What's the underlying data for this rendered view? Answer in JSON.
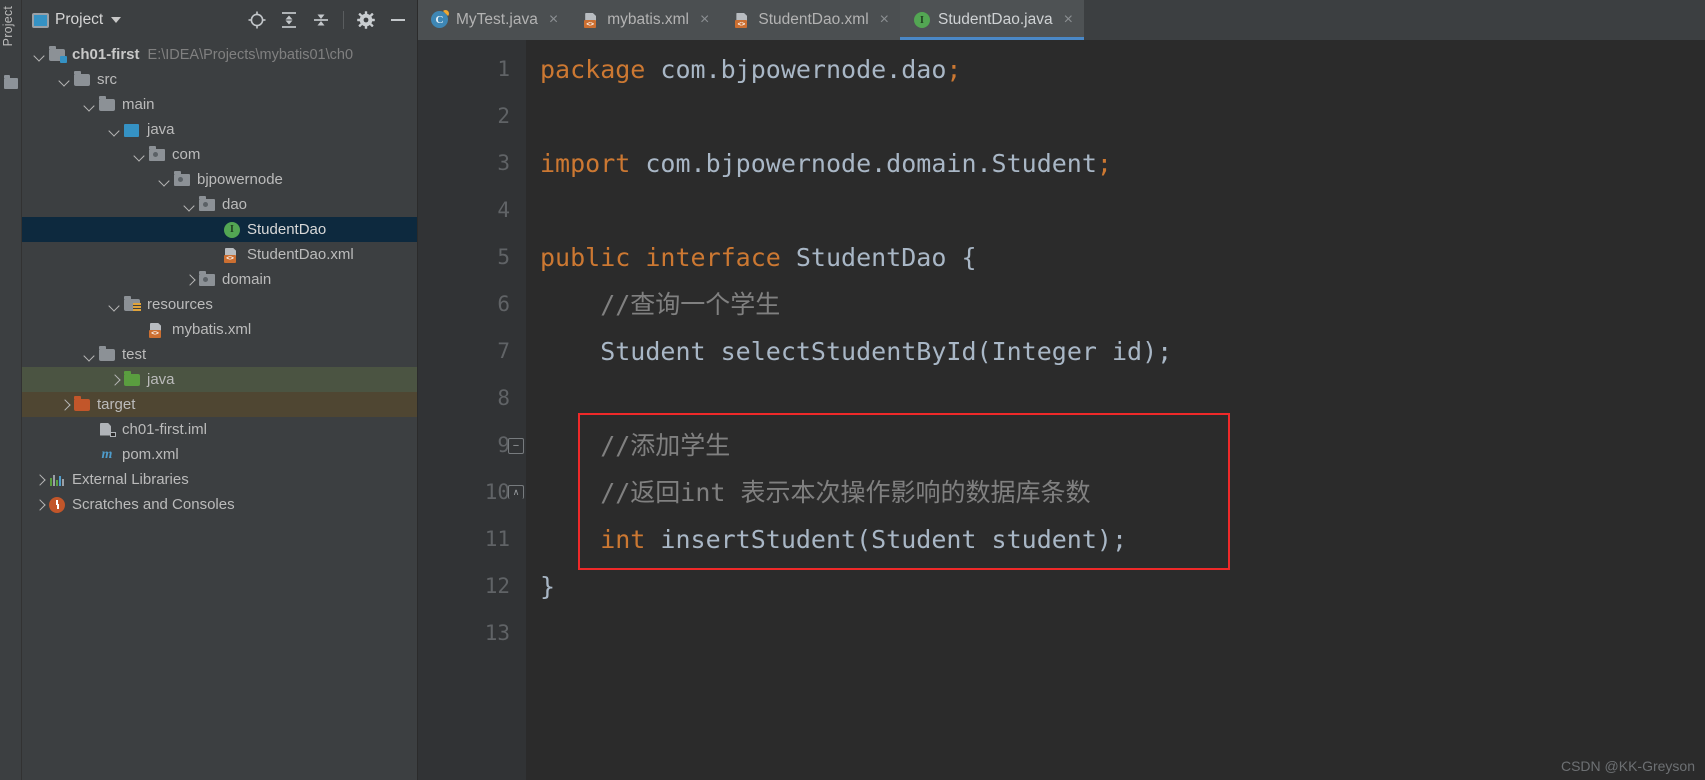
{
  "left_strip": {
    "label": "Project",
    "icon": "project-tool-window-icon"
  },
  "project_panel": {
    "header": {
      "title": "Project",
      "icon": "project-view-icon",
      "dropdown_icon": "chevron-down-icon",
      "buttons": [
        {
          "name": "locate-icon",
          "label": ""
        },
        {
          "name": "expand-all-icon",
          "label": ""
        },
        {
          "name": "collapse-all-icon",
          "label": ""
        },
        {
          "name": "gear-icon",
          "label": ""
        },
        {
          "name": "minimize-icon",
          "label": ""
        }
      ]
    },
    "tree": [
      {
        "label": "ch01-first",
        "path": "E:\\IDEA\\Projects\\mybatis01\\ch0",
        "arrow": "down",
        "icon": "module-folder-icon",
        "indent": 0,
        "bold": true,
        "state": "normal"
      },
      {
        "label": "src",
        "arrow": "down",
        "icon": "folder-icon",
        "indent": 1,
        "state": "normal"
      },
      {
        "label": "main",
        "arrow": "down",
        "icon": "folder-icon",
        "indent": 2,
        "state": "normal"
      },
      {
        "label": "java",
        "arrow": "down",
        "icon": "source-root-icon",
        "indent": 3,
        "state": "normal"
      },
      {
        "label": "com",
        "arrow": "down",
        "icon": "package-icon",
        "indent": 4,
        "state": "normal"
      },
      {
        "label": "bjpowernode",
        "arrow": "down",
        "icon": "package-icon",
        "indent": 5,
        "state": "normal"
      },
      {
        "label": "dao",
        "arrow": "down",
        "icon": "package-icon",
        "indent": 6,
        "state": "normal"
      },
      {
        "label": "StudentDao",
        "arrow": "none",
        "icon": "interface-icon",
        "indent": 7,
        "state": "selected"
      },
      {
        "label": "StudentDao.xml",
        "arrow": "none",
        "icon": "xml-file-icon",
        "indent": 7,
        "state": "normal"
      },
      {
        "label": "domain",
        "arrow": "right",
        "icon": "package-icon",
        "indent": 6,
        "state": "normal"
      },
      {
        "label": "resources",
        "arrow": "down",
        "icon": "resources-folder-icon",
        "indent": 3,
        "state": "normal"
      },
      {
        "label": "mybatis.xml",
        "arrow": "none",
        "icon": "xml-file-icon",
        "indent": 4,
        "state": "normal"
      },
      {
        "label": "test",
        "arrow": "down",
        "icon": "folder-icon",
        "indent": 2,
        "state": "normal"
      },
      {
        "label": "java",
        "arrow": "right",
        "icon": "test-source-root-icon",
        "indent": 3,
        "state": "tint-green"
      },
      {
        "label": "target",
        "arrow": "right",
        "icon": "excluded-folder-icon",
        "indent": 1,
        "state": "tint-olive"
      },
      {
        "label": "ch01-first.iml",
        "arrow": "none",
        "icon": "iml-file-icon",
        "indent": 2,
        "state": "normal"
      },
      {
        "label": "pom.xml",
        "arrow": "none",
        "icon": "maven-file-icon",
        "indent": 2,
        "state": "normal"
      },
      {
        "label": "External Libraries",
        "arrow": "right",
        "icon": "libraries-icon",
        "indent": 0,
        "state": "normal"
      },
      {
        "label": "Scratches and Consoles",
        "arrow": "right",
        "icon": "scratches-icon",
        "indent": 0,
        "state": "normal"
      }
    ]
  },
  "editor": {
    "tabs": [
      {
        "label": "MyTest.java",
        "icon": "java-class-icon",
        "active": false,
        "close_icon": "close-icon"
      },
      {
        "label": "mybatis.xml",
        "icon": "xml-file-icon",
        "active": false,
        "close_icon": "close-icon"
      },
      {
        "label": "StudentDao.xml",
        "icon": "xml-file-icon",
        "active": false,
        "close_icon": "close-icon"
      },
      {
        "label": "StudentDao.java",
        "icon": "interface-icon",
        "active": true,
        "close_icon": "close-icon"
      }
    ],
    "line_numbers": [
      "1",
      "2",
      "3",
      "4",
      "5",
      "6",
      "7",
      "8",
      "9",
      "10",
      "11",
      "12",
      "13"
    ],
    "lines": [
      {
        "num": "1",
        "tokens": [
          {
            "t": "package",
            "c": "kw"
          },
          {
            "t": " com.bjpowernode.dao",
            "c": "id"
          },
          {
            "t": ";",
            "c": "kw"
          }
        ]
      },
      {
        "num": "2",
        "tokens": []
      },
      {
        "num": "3",
        "tokens": [
          {
            "t": "import",
            "c": "kw"
          },
          {
            "t": " com.bjpowernode.domain.Student",
            "c": "id"
          },
          {
            "t": ";",
            "c": "kw"
          }
        ]
      },
      {
        "num": "4",
        "tokens": []
      },
      {
        "num": "5",
        "tokens": [
          {
            "t": "public interface",
            "c": "kw"
          },
          {
            "t": " StudentDao {",
            "c": "id"
          }
        ]
      },
      {
        "num": "6",
        "tokens": [
          {
            "t": "    //查询一个学生",
            "c": "cm"
          }
        ]
      },
      {
        "num": "7",
        "tokens": [
          {
            "t": "    Student",
            "c": "id"
          },
          {
            "t": " selectStudentById",
            "c": "mth"
          },
          {
            "t": "(Integer id);",
            "c": "id"
          }
        ]
      },
      {
        "num": "8",
        "tokens": []
      },
      {
        "num": "9",
        "tokens": [
          {
            "t": "    //添加学生",
            "c": "cm"
          }
        ]
      },
      {
        "num": "10",
        "tokens": [
          {
            "t": "    //返回int 表示本次操作影响的数据库条数",
            "c": "cm"
          }
        ]
      },
      {
        "num": "11",
        "tokens": [
          {
            "t": "    int",
            "c": "kw"
          },
          {
            "t": " insertStudent",
            "c": "mth"
          },
          {
            "t": "(Student student);",
            "c": "id"
          }
        ]
      },
      {
        "num": "12",
        "tokens": [
          {
            "t": "}",
            "c": "id"
          }
        ]
      },
      {
        "num": "13",
        "tokens": []
      }
    ],
    "fold_markers": [
      {
        "line": "9",
        "type": "fold-start-icon"
      },
      {
        "line": "10",
        "type": "fold-end-icon"
      }
    ],
    "annotation": {
      "name": "red-highlight-box",
      "color": "#ef2929",
      "covers_lines": [
        "9",
        "10",
        "11"
      ]
    }
  },
  "watermark": {
    "text": "CSDN @KK-Greyson"
  },
  "colors": {
    "keyword": "#cc7832",
    "identifier": "#a9b7c6",
    "comment": "#808080",
    "editor_bg": "#2b2b2b",
    "gutter_bg": "#313335",
    "panel_bg": "#3c3f41",
    "selection": "#0d293e",
    "active_tab_underline": "#4a88c7",
    "annotation_red": "#ef2929"
  }
}
